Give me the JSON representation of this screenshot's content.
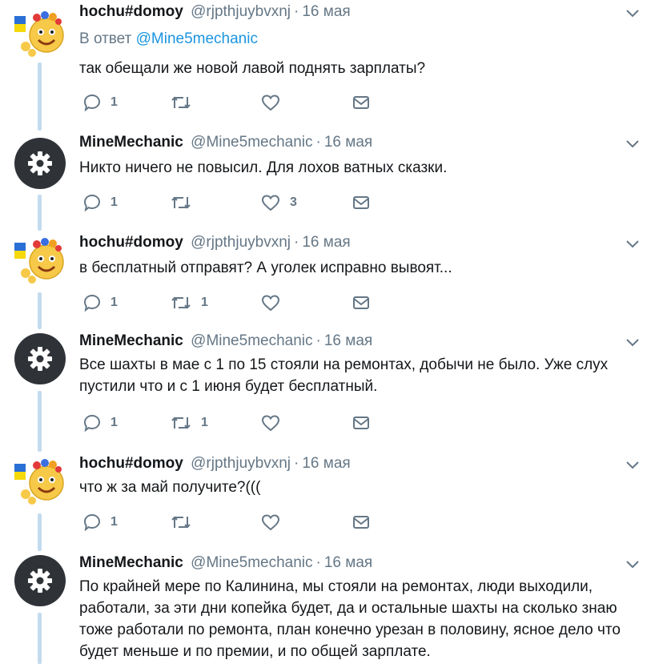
{
  "tweets": [
    {
      "name": "hochu#domoy",
      "handle": "@rjpthjuybvxnj",
      "sep": "·",
      "time": "16 мая",
      "reply_prefix": "В ответ",
      "reply_to": "@Mine5mechanic",
      "text": "так обещали же  новой лавой поднять зарплаты?",
      "replies": "1",
      "retweets": "",
      "likes": ""
    },
    {
      "name": "MineMechanic",
      "handle": "@Mine5mechanic",
      "sep": "·",
      "time": "16 мая",
      "text": "Никто ничего не повысил. Для лохов ватных сказки.",
      "replies": "1",
      "retweets": "",
      "likes": "3"
    },
    {
      "name": "hochu#domoy",
      "handle": "@rjpthjuybvxnj",
      "sep": "·",
      "time": "16 мая",
      "text": "в бесплатный отправят? А уголек исправно вывоят...",
      "replies": "1",
      "retweets": "1",
      "likes": ""
    },
    {
      "name": "MineMechanic",
      "handle": "@Mine5mechanic",
      "sep": "·",
      "time": "16 мая",
      "text": "Все шахты в мае с 1 по 15 стояли на ремонтах, добычи не было. Уже слух пустили что и с 1 июня будет бесплатный.",
      "replies": "1",
      "retweets": "1",
      "likes": ""
    },
    {
      "name": "hochu#domoy",
      "handle": "@rjpthjuybvxnj",
      "sep": "·",
      "time": "16 мая",
      "text": "что ж за май получите?(((",
      "replies": "1",
      "retweets": "",
      "likes": ""
    },
    {
      "name": "MineMechanic",
      "handle": "@Mine5mechanic",
      "sep": "·",
      "time": "16 мая",
      "text": "По крайней мере по Калинина, мы стояли на ремонтах, люди выходили, работали, за эти дни копейка будет, да и остальные шахты на сколько знаю тоже работали по ремонта, план конечно урезан в половину, ясное дело что будет меньше и по премии, и по общей зарплате.",
      "replies": "",
      "retweets": "",
      "likes": ""
    }
  ],
  "colors": {
    "accent": "#1b95e0",
    "muted": "#657786",
    "thread_line": "#c4dbee",
    "gear_avatar": "#2f3338"
  },
  "icons": [
    "reply-icon",
    "retweet-icon",
    "like-icon",
    "message-icon",
    "chevron-down-icon",
    "gear-icon"
  ]
}
